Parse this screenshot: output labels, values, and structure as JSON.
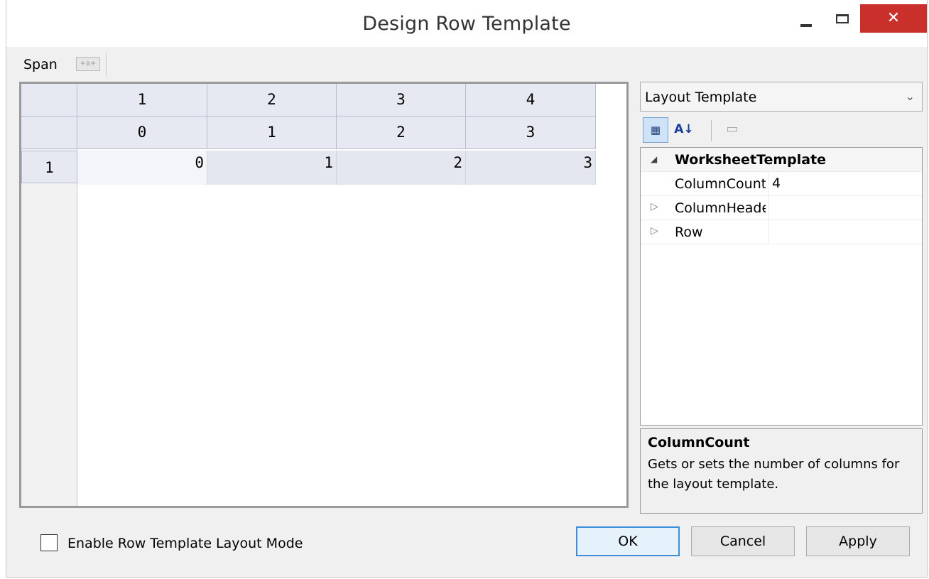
{
  "window": {
    "title": "Design Row Template",
    "close_glyph": "✕"
  },
  "toolbar": {
    "span_label": "Span",
    "span_icon_text": "+a+"
  },
  "grid": {
    "column_headers": [
      "1",
      "2",
      "3",
      "4"
    ],
    "column_indices": [
      "0",
      "1",
      "2",
      "3"
    ],
    "row_header": "1",
    "row_cells": [
      "0",
      "1",
      "2",
      "3"
    ]
  },
  "property_panel": {
    "dropdown_value": "Layout Template",
    "dropdown_arrow": "⌄",
    "categorized_icon": "▦",
    "sort_az_icon": "A↓",
    "property_pages_icon": "▭",
    "category": {
      "expander": "◢",
      "name": "WorksheetTemplate"
    },
    "rows": [
      {
        "expander": "",
        "name": "ColumnCount",
        "value": "4"
      },
      {
        "expander": "▷",
        "name": "ColumnHeade",
        "value": ""
      },
      {
        "expander": "▷",
        "name": "Row",
        "value": ""
      }
    ]
  },
  "description": {
    "title": "ColumnCount",
    "text": "Gets or sets the number of columns for the layout template."
  },
  "footer": {
    "checkbox_label": "Enable Row Template Layout Mode",
    "ok_label": "OK",
    "cancel_label": "Cancel",
    "apply_label": "Apply"
  }
}
